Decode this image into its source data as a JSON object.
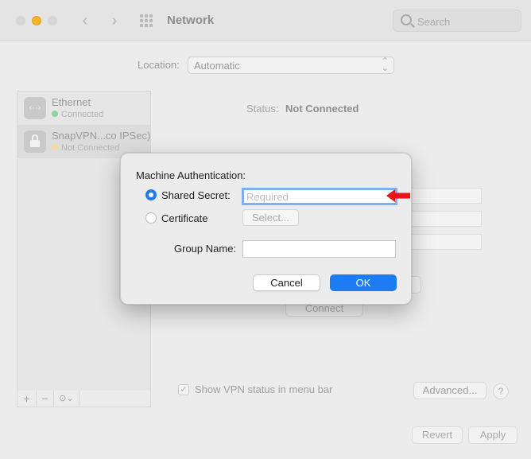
{
  "window": {
    "title": "Network",
    "search_placeholder": "Search"
  },
  "location": {
    "label": "Location:",
    "value": "Automatic"
  },
  "sidebar": {
    "items": [
      {
        "name": "Ethernet",
        "status": "Connected",
        "status_color": "#8fd49a",
        "icon": "ethernet-icon"
      },
      {
        "name": "SnapVPN...co IPSec)",
        "status": "Not Connected",
        "status_color": "#f1dc9c",
        "icon": "lock-icon"
      }
    ],
    "tools": {
      "add": "+",
      "remove": "−",
      "action": "⊙⌄"
    }
  },
  "main": {
    "status_label": "Status:",
    "status_value": "Not Connected",
    "connect_label": "Connect",
    "show_vpn_label": "Show VPN status in menu bar",
    "show_vpn_checked": true,
    "advanced_label": "Advanced...",
    "help_label": "?",
    "revert_label": "Revert",
    "apply_label": "Apply"
  },
  "dialog": {
    "title": "Machine Authentication:",
    "shared_secret_label": "Shared Secret:",
    "shared_secret_placeholder": "Required",
    "shared_secret_selected": true,
    "certificate_label": "Certificate",
    "select_label": "Select...",
    "group_name_label": "Group Name:",
    "group_name_value": "",
    "cancel_label": "Cancel",
    "ok_label": "OK",
    "accent_color": "#1e7cf2",
    "annotation_arrow_color": "#e8141b"
  }
}
